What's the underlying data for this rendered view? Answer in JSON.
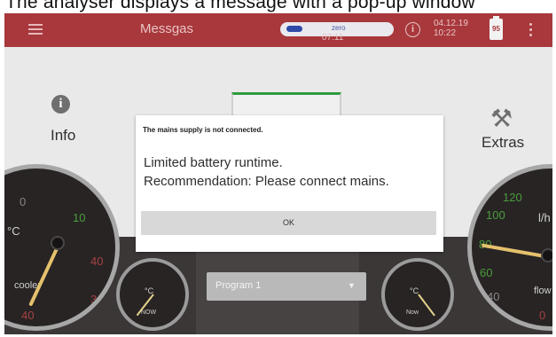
{
  "caption": "The analyser displays a message with a pop-up window",
  "topbar": {
    "title": "Messgas",
    "status_pill": "zero",
    "elapsed": "07:11",
    "date": "04.12.19",
    "time": "10:22",
    "battery": "95",
    "info_symbol": "i"
  },
  "panel": {
    "info_symbol": "i",
    "info_label": "Info",
    "extras_label": "Extras",
    "extras_icon": "tools-icon"
  },
  "gauges": {
    "left": {
      "unit": "°C",
      "label": "cooler",
      "ticks": [
        "0",
        "10",
        "40",
        "30",
        "40"
      ]
    },
    "right": {
      "unit": "l/h",
      "label": "flow",
      "ticks": [
        "120",
        "100",
        "80",
        "60",
        "40",
        "0"
      ]
    },
    "small_left": {
      "unit": "°C",
      "label": "NOW"
    },
    "small_right": {
      "unit": "°C",
      "label": "Now"
    }
  },
  "program": {
    "selected": "Program 1"
  },
  "dialog": {
    "heading": "The mains supply is not connected.",
    "line1": "Limited battery runtime.",
    "line2": "Recommendation: Please connect mains.",
    "ok_label": "OK"
  },
  "colors": {
    "topbar": "#a8383c",
    "accent_green": "#2e9b3f",
    "needle": "#e5c16d"
  }
}
